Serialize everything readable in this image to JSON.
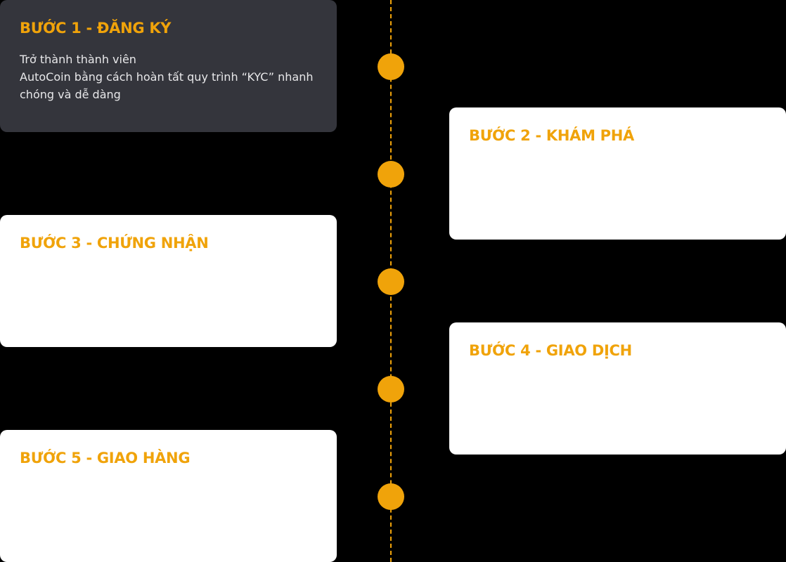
{
  "steps": [
    {
      "title": "BƯỚC 1 - ĐĂNG KÝ",
      "description": "Trở thành thành viên\nAutoCoin bằng cách hoàn tất quy trình “KYC” nhanh chóng và dễ dàng"
    },
    {
      "title": "BƯỚC 2 - KHÁM PHÁ"
    },
    {
      "title": "BƯỚC 3 - CHỨNG NHẬN"
    },
    {
      "title": "BƯỚC 4 - GIAO DỊCH"
    },
    {
      "title": "BƯỚC 5 - GIAO HÀNG"
    }
  ],
  "colors": {
    "accent": "#f0a30a",
    "active_card": "#34353c",
    "card": "#ffffff",
    "background": "#000000"
  }
}
